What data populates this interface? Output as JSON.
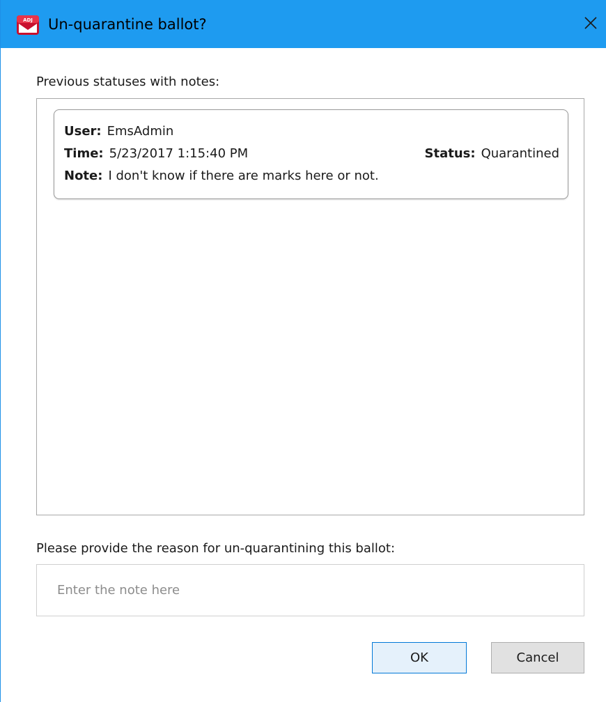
{
  "window": {
    "title": "Un-quarantine ballot?",
    "app_icon_text": "ADJ",
    "accent_color": "#1e9bf0"
  },
  "notes_section": {
    "label": "Previous statuses with notes:",
    "entries": [
      {
        "user_label": "User:",
        "user": "EmsAdmin",
        "time_label": "Time:",
        "time": "5/23/2017 1:15:40 PM",
        "status_label": "Status:",
        "status": "Quarantined",
        "note_label": "Note:",
        "note": "I don't know if there are marks here or not."
      }
    ]
  },
  "reason_section": {
    "label": "Please provide the reason for un-quarantining this ballot:",
    "input_value": "",
    "input_placeholder": "Enter the note here"
  },
  "buttons": {
    "ok_label": "OK",
    "cancel_label": "Cancel"
  },
  "icons": {
    "app": "ballot-app-icon",
    "close": "close-icon"
  }
}
